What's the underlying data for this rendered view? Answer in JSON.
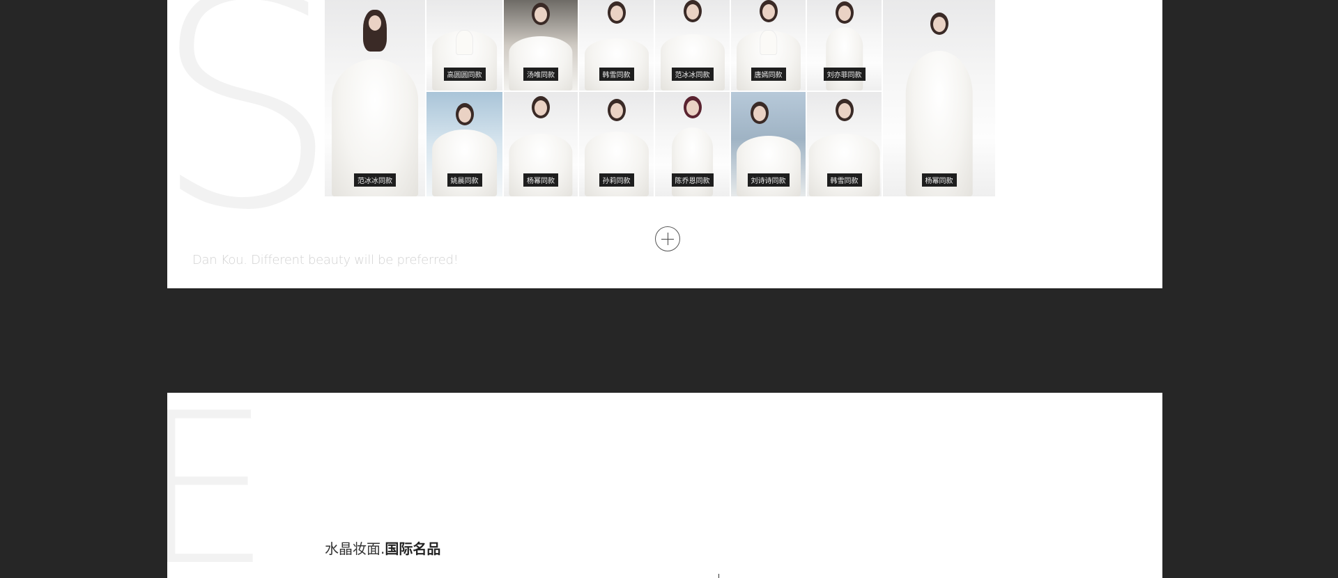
{
  "gallery": {
    "photos": [
      {
        "caption": "范冰冰同款"
      },
      {
        "caption": "高圆圆同款"
      },
      {
        "caption": "汤唯同款"
      },
      {
        "caption": "韩雪同款"
      },
      {
        "caption": "范冰冰同款"
      },
      {
        "caption": "唐嫣同款"
      },
      {
        "caption": "刘亦菲同款"
      },
      {
        "caption": "杨幂同款"
      },
      {
        "caption": "姚晨同款"
      },
      {
        "caption": "杨幂同款"
      },
      {
        "caption": "孙莉同款"
      },
      {
        "caption": "陈乔恩同款"
      },
      {
        "caption": "刘诗诗同款"
      },
      {
        "caption": "韩雪同款"
      }
    ]
  },
  "tagline": "Dan Kou. Different beauty will be preferred!",
  "section": {
    "title_light": "水晶妆面.",
    "title_bold": "国际名品"
  }
}
